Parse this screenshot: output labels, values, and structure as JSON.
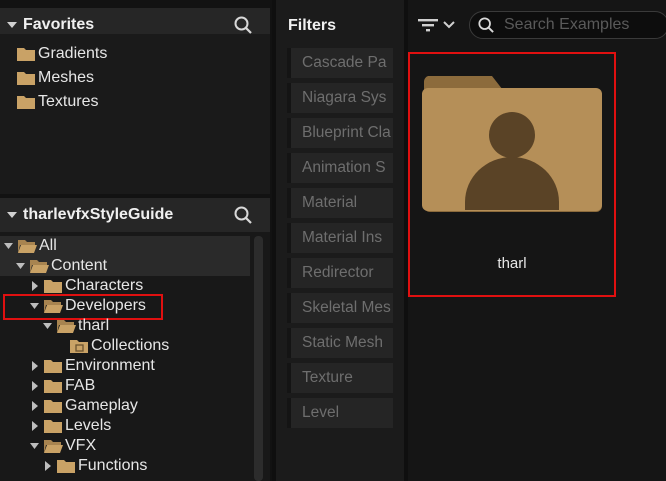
{
  "favorites": {
    "title": "Favorites",
    "items": [
      {
        "label": "Gradients"
      },
      {
        "label": "Meshes"
      },
      {
        "label": "Textures"
      }
    ]
  },
  "tree": {
    "title": "tharlevfxStyleGuide",
    "items": [
      {
        "label": "All",
        "expanded": true,
        "selected": true
      },
      {
        "label": "Content",
        "expanded": true,
        "selected": true
      },
      {
        "label": "Characters",
        "expanded": false
      },
      {
        "label": "Developers",
        "expanded": true,
        "highlighted": true
      },
      {
        "label": "tharl",
        "expanded": true
      },
      {
        "label": "Collections"
      },
      {
        "label": "Environment",
        "expanded": false
      },
      {
        "label": "FAB",
        "expanded": false
      },
      {
        "label": "Gameplay",
        "expanded": false
      },
      {
        "label": "Levels",
        "expanded": false
      },
      {
        "label": "VFX",
        "expanded": true
      },
      {
        "label": "Functions",
        "expanded": false
      }
    ]
  },
  "filters": {
    "title": "Filters",
    "items": [
      {
        "label": "Cascade Pa"
      },
      {
        "label": "Niagara Sys"
      },
      {
        "label": "Blueprint Cla"
      },
      {
        "label": "Animation S"
      },
      {
        "label": "Material"
      },
      {
        "label": "Material Ins"
      },
      {
        "label": "Redirector"
      },
      {
        "label": "Skeletal Mes"
      },
      {
        "label": "Static Mesh"
      },
      {
        "label": "Texture"
      },
      {
        "label": "Level"
      }
    ]
  },
  "content": {
    "search_placeholder": "Search Examples",
    "search_value": "",
    "assets": [
      {
        "label": "tharl",
        "type": "user-folder",
        "highlighted": true
      }
    ]
  },
  "colors": {
    "folder": "#c9a266",
    "highlight": "#e01010",
    "asset_folder": "#b58f58"
  }
}
